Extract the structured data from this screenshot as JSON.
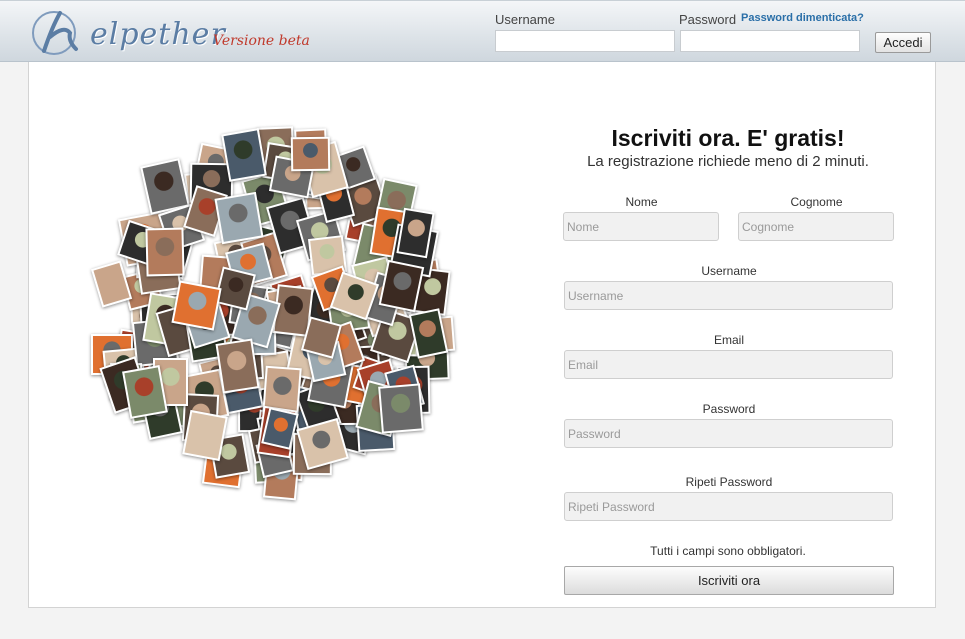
{
  "header": {
    "logo_text": "elpether",
    "logo_beta": "Versione beta",
    "username_label": "Username",
    "password_label": "Password",
    "forgot_link": "Password dimenticata?",
    "login_button": "Accedi",
    "username_value": "",
    "password_value": ""
  },
  "form": {
    "title": "Iscriviti ora. E' gratis!",
    "subtitle": "La registrazione richiede meno di 2 minuti.",
    "nome_label": "Nome",
    "nome_placeholder": "Nome",
    "cognome_label": "Cognome",
    "cognome_placeholder": "Cognome",
    "username_label": "Username",
    "username_placeholder": "Username",
    "email_label": "Email",
    "email_placeholder": "Email",
    "password_label": "Password",
    "password_placeholder": "Password",
    "repeat_label": "Ripeti Password",
    "repeat_placeholder": "Ripeti Password",
    "required_note": "Tutti i campi sono obbligatori.",
    "submit_button": "Iscriviti ora"
  },
  "colors": {
    "logo_blue": "#5b7da4",
    "beta_red": "#c0392b",
    "link_blue": "#2a6fa8"
  }
}
